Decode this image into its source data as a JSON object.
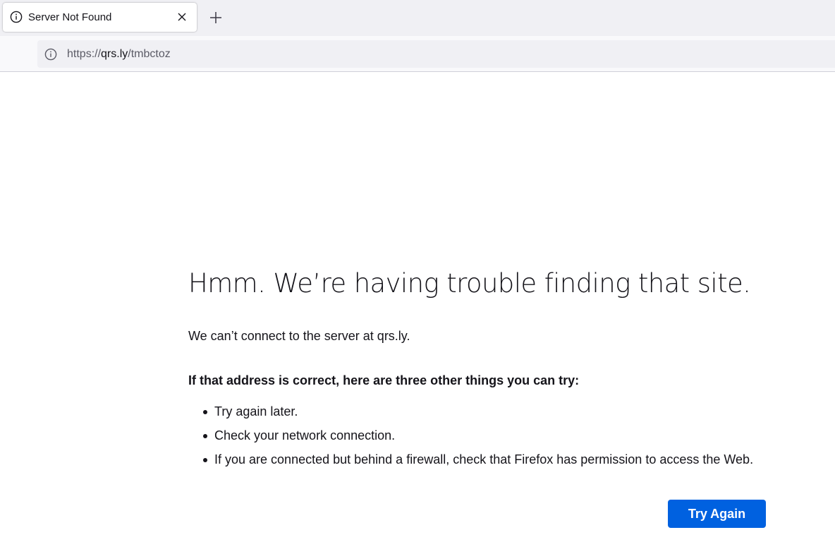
{
  "tab": {
    "title": "Server Not Found",
    "icon": "info-icon",
    "close_icon": "close-icon"
  },
  "newtab": {
    "icon": "plus-icon"
  },
  "urlbar": {
    "icon": "info-icon",
    "scheme": "https://",
    "host": "qrs.ly",
    "path": "/tmbctoz"
  },
  "error": {
    "title": "Hmm. We’re having trouble finding that site.",
    "description": "We can’t connect to the server at qrs.ly.",
    "tips_heading": "If that address is correct, here are three other things you can try:",
    "tips": [
      "Try again later.",
      "Check your network connection.",
      "If you are connected but behind a firewall, check that Firefox has permission to access the Web."
    ],
    "try_again_label": "Try Again"
  },
  "colors": {
    "accent": "#0061e0",
    "tabstrip_bg": "#f0f0f4",
    "text": "#15141a"
  }
}
